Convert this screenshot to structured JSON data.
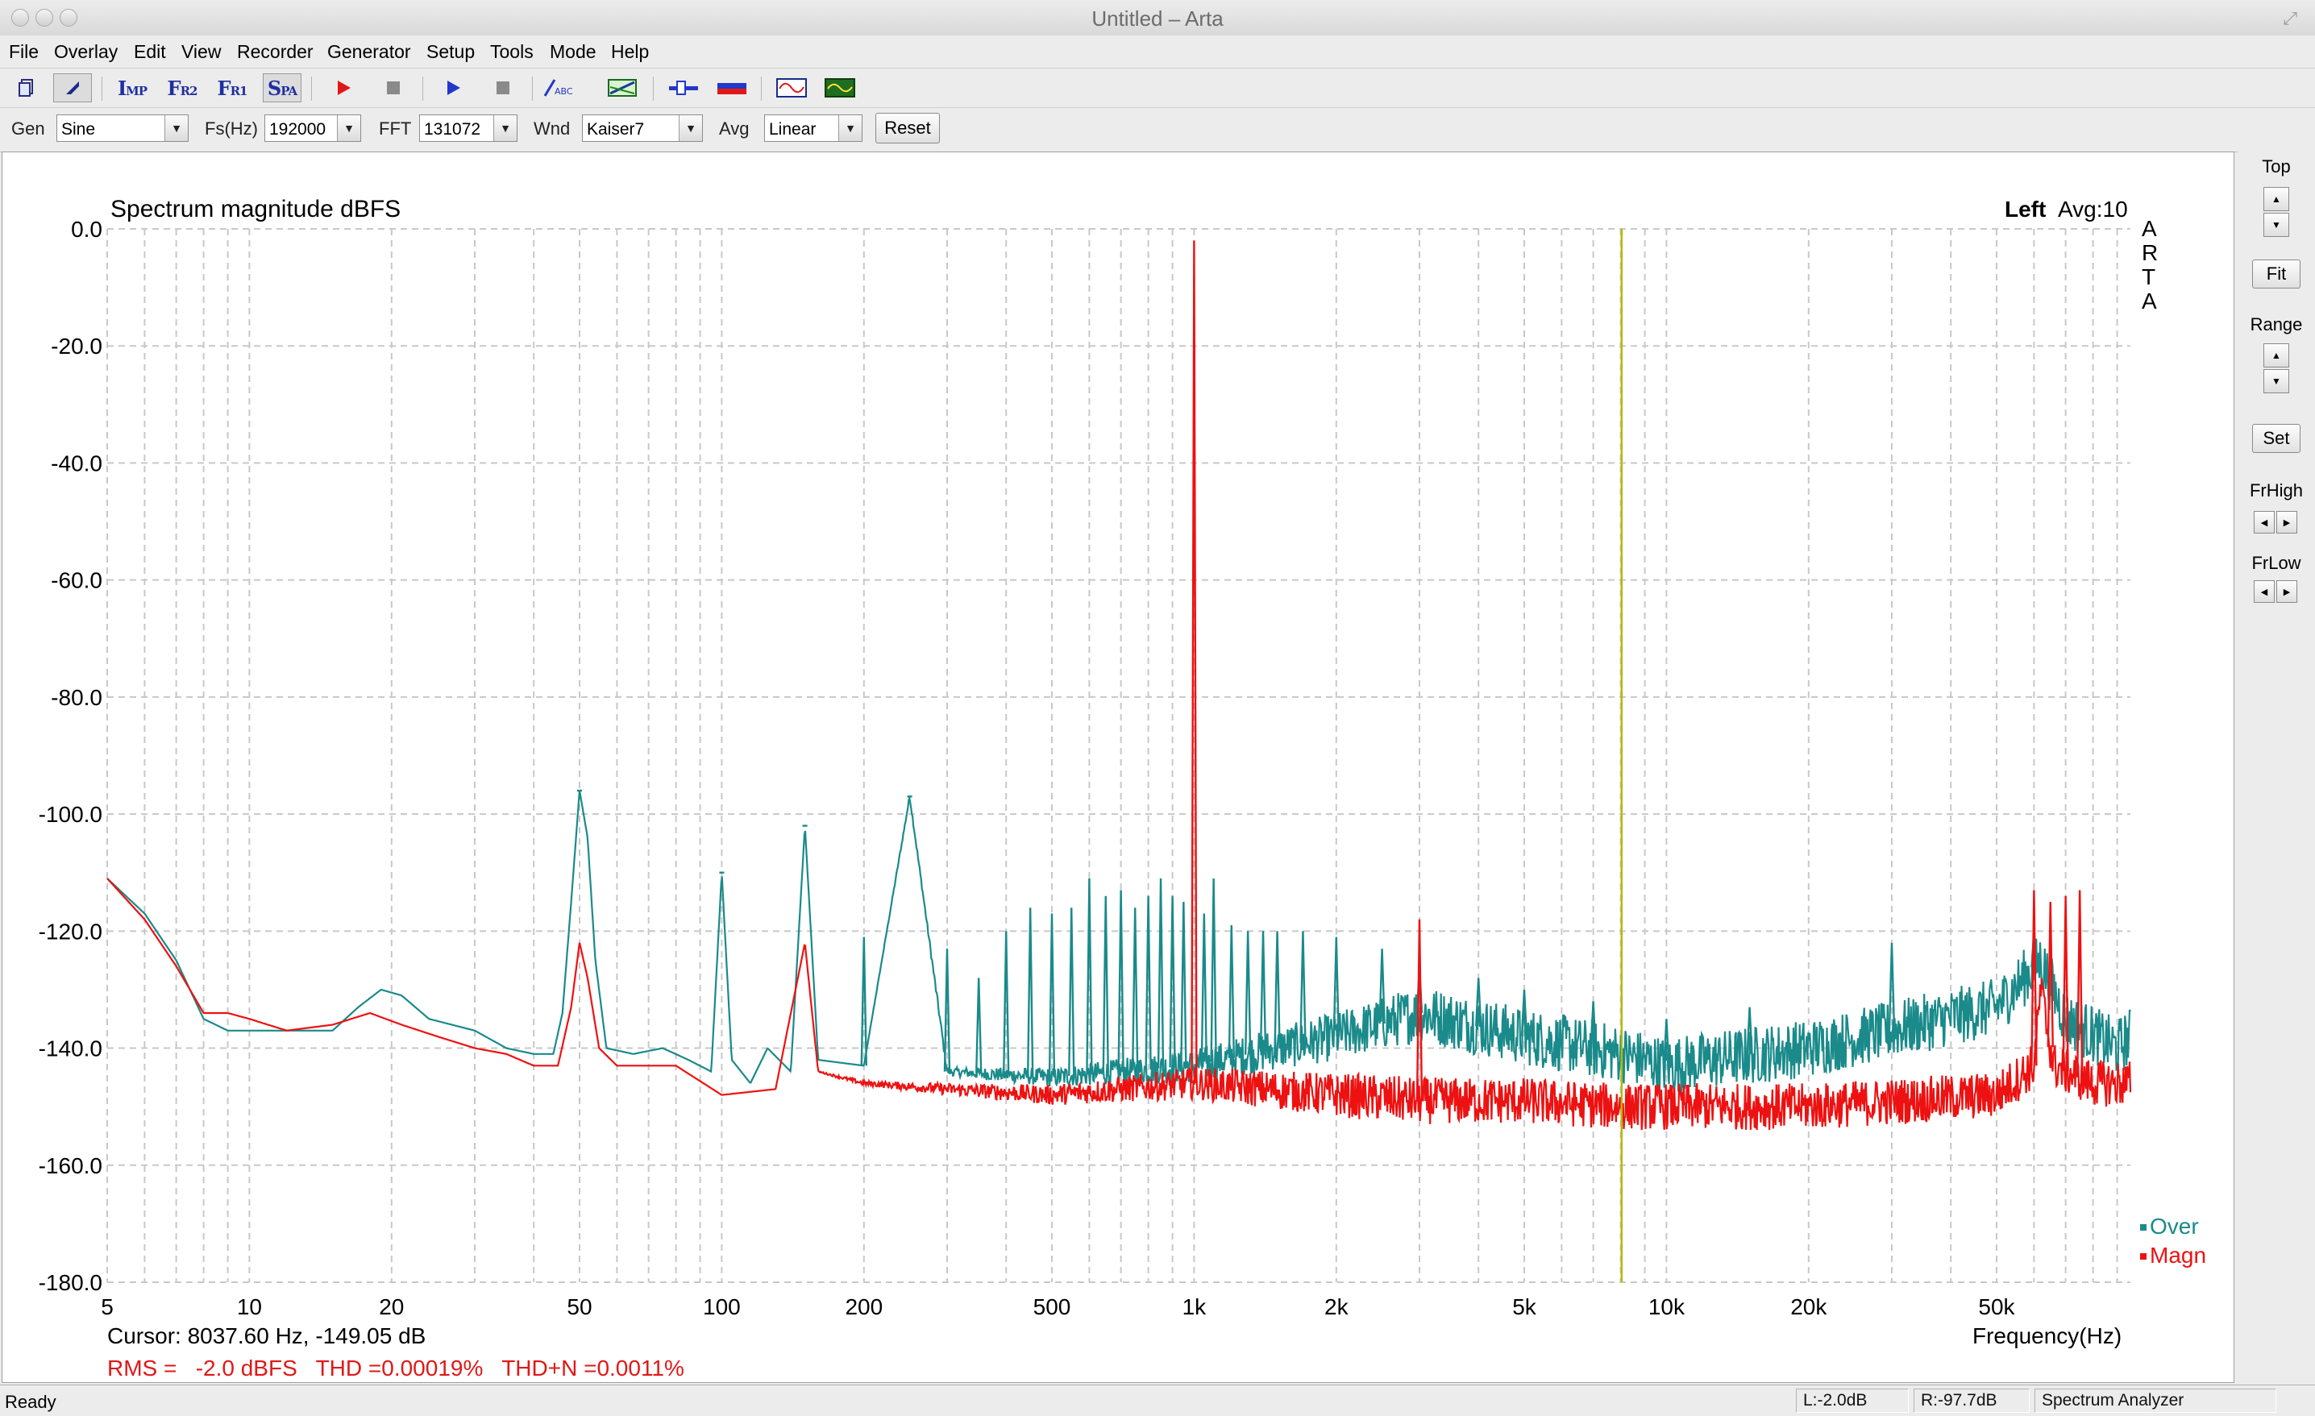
{
  "window": {
    "title": "Untitled – Arta"
  },
  "menu": [
    "File",
    "Overlay",
    "Edit",
    "View",
    "Recorder",
    "Generator",
    "Setup",
    "Tools",
    "Mode",
    "Help"
  ],
  "toolbar": {
    "imp": {
      "big": "I",
      "small": "MP"
    },
    "fr2": {
      "big": "F",
      "small": "R2"
    },
    "fr1": {
      "big": "F",
      "small": "R1"
    },
    "spa": {
      "big": "S",
      "small": "PA"
    },
    "abc": "ABC"
  },
  "params": {
    "gen_label": "Gen",
    "gen_value": "Sine",
    "fs_label": "Fs(Hz)",
    "fs_value": "192000",
    "fft_label": "FFT",
    "fft_value": "131072",
    "wnd_label": "Wnd",
    "wnd_value": "Kaiser7",
    "avg_label": "Avg",
    "avg_value": "Linear",
    "reset_label": "Reset"
  },
  "right_panel": {
    "top_label": "Top",
    "fit_label": "Fit",
    "range_label": "Range",
    "set_label": "Set",
    "frhigh_label": "FrHigh",
    "frlow_label": "FrLow"
  },
  "plot": {
    "title": "Spectrum magnitude dBFS",
    "channel": "Left",
    "avg": "Avg:10",
    "arta": [
      "A",
      "R",
      "T",
      "A"
    ],
    "cursor": "Cursor: 8037.60 Hz, -149.05 dB",
    "rms": "RMS =   -2.0 dBFS   THD =0.00019%   THD+N =0.0011%",
    "xlabel": "Frequency(Hz)",
    "legend": [
      "Over",
      "Magn"
    ]
  },
  "status": {
    "ready": "Ready",
    "left_level": "L:-2.0dB",
    "right_level": "R:-97.7dB",
    "mode": "Spectrum Analyzer"
  },
  "colors": {
    "over": "#1a8a8a",
    "magn": "#ee1111",
    "cursor": "#b5b800",
    "grid": "#c8c8c8"
  },
  "chart_data": {
    "type": "line",
    "title": "Spectrum magnitude dBFS",
    "xlabel": "Frequency(Hz)",
    "ylabel": "",
    "x_scale": "log",
    "xlim": [
      5,
      96000
    ],
    "ylim": [
      -180,
      0
    ],
    "x_ticks": [
      5,
      10,
      20,
      50,
      100,
      200,
      500,
      1000,
      2000,
      5000,
      10000,
      20000,
      50000
    ],
    "x_tick_labels": [
      "5",
      "10",
      "20",
      "50",
      "100",
      "200",
      "500",
      "1k",
      "2k",
      "5k",
      "10k",
      "20k",
      "50k"
    ],
    "y_ticks": [
      0,
      -20,
      -40,
      -60,
      -80,
      -100,
      -120,
      -140,
      -160,
      -180
    ],
    "y_tick_labels": [
      "0.0",
      "-20.0",
      "-40.0",
      "-60.0",
      "-80.0",
      "-100.0",
      "-120.0",
      "-140.0",
      "-160.0",
      "-180.0"
    ],
    "grid": true,
    "legend_position": "bottom-right",
    "cursor_x": 8037.6,
    "cursor_y": -149.05,
    "series": [
      {
        "name": "Over",
        "color": "#1a8a8a",
        "points": [
          [
            5,
            -111
          ],
          [
            6,
            -117
          ],
          [
            7,
            -125
          ],
          [
            8,
            -135
          ],
          [
            9,
            -137
          ],
          [
            10,
            -137
          ],
          [
            12,
            -137
          ],
          [
            15,
            -137
          ],
          [
            17,
            -133
          ],
          [
            19,
            -130
          ],
          [
            21,
            -131
          ],
          [
            24,
            -135
          ],
          [
            30,
            -137
          ],
          [
            35,
            -140
          ],
          [
            40,
            -141
          ],
          [
            44,
            -141
          ],
          [
            46,
            -134
          ],
          [
            48,
            -115
          ],
          [
            50,
            -96
          ],
          [
            52,
            -104
          ],
          [
            54,
            -125
          ],
          [
            57,
            -140
          ],
          [
            65,
            -141
          ],
          [
            75,
            -140
          ],
          [
            85,
            -142
          ],
          [
            95,
            -144
          ],
          [
            100,
            -110
          ],
          [
            105,
            -142
          ],
          [
            115,
            -146
          ],
          [
            125,
            -140
          ],
          [
            140,
            -144
          ],
          [
            150,
            -102
          ],
          [
            160,
            -142
          ],
          [
            200,
            -143
          ],
          [
            250,
            -97
          ],
          [
            300,
            -144
          ],
          [
            500,
            -145
          ],
          [
            1000,
            -143
          ],
          [
            2000,
            -138
          ],
          [
            3000,
            -134
          ],
          [
            5000,
            -138
          ],
          [
            8000,
            -141
          ],
          [
            10000,
            -143
          ],
          [
            20000,
            -140
          ],
          [
            50000,
            -133
          ],
          [
            62000,
            -125
          ],
          [
            70000,
            -135
          ],
          [
            90000,
            -140
          ],
          [
            96000,
            -138
          ]
        ],
        "peaks": [
          [
            50,
            -96
          ],
          [
            100,
            -110
          ],
          [
            150,
            -102
          ],
          [
            200,
            -121
          ],
          [
            250,
            -97
          ],
          [
            300,
            -123
          ],
          [
            350,
            -128
          ],
          [
            400,
            -120
          ],
          [
            450,
            -116
          ],
          [
            500,
            -117
          ],
          [
            550,
            -116
          ],
          [
            600,
            -111
          ],
          [
            650,
            -114
          ],
          [
            700,
            -113
          ],
          [
            750,
            -116
          ],
          [
            800,
            -114
          ],
          [
            850,
            -111
          ],
          [
            900,
            -114
          ],
          [
            950,
            -115
          ],
          [
            1050,
            -117
          ],
          [
            1100,
            -111
          ],
          [
            1200,
            -119
          ],
          [
            1300,
            -120
          ],
          [
            1400,
            -120
          ],
          [
            1500,
            -120
          ],
          [
            1700,
            -120
          ],
          [
            2000,
            -121
          ],
          [
            2500,
            -123
          ],
          [
            3000,
            -126
          ],
          [
            4000,
            -128
          ],
          [
            5000,
            -130
          ],
          [
            7000,
            -132
          ],
          [
            10000,
            -135
          ],
          [
            15000,
            -133
          ],
          [
            30000,
            -122
          ],
          [
            60000,
            -120
          ]
        ]
      },
      {
        "name": "Magn",
        "color": "#ee1111",
        "points": [
          [
            5,
            -111
          ],
          [
            6,
            -118
          ],
          [
            7,
            -126
          ],
          [
            8,
            -134
          ],
          [
            9,
            -134
          ],
          [
            10,
            -135
          ],
          [
            12,
            -137
          ],
          [
            15,
            -136
          ],
          [
            18,
            -134
          ],
          [
            21,
            -136
          ],
          [
            25,
            -138
          ],
          [
            30,
            -140
          ],
          [
            35,
            -141
          ],
          [
            40,
            -143
          ],
          [
            45,
            -143
          ],
          [
            48,
            -133
          ],
          [
            50,
            -122
          ],
          [
            52,
            -128
          ],
          [
            55,
            -140
          ],
          [
            60,
            -143
          ],
          [
            80,
            -143
          ],
          [
            100,
            -148
          ],
          [
            130,
            -147
          ],
          [
            150,
            -122
          ],
          [
            160,
            -144
          ],
          [
            200,
            -146
          ],
          [
            300,
            -147
          ],
          [
            500,
            -148
          ],
          [
            1000,
            -146
          ],
          [
            2000,
            -148
          ],
          [
            3000,
            -149
          ],
          [
            5000,
            -149
          ],
          [
            8000,
            -150
          ],
          [
            10000,
            -150
          ],
          [
            20000,
            -150
          ],
          [
            50000,
            -148
          ],
          [
            60000,
            -143
          ],
          [
            62000,
            -130
          ],
          [
            66000,
            -143
          ],
          [
            80000,
            -146
          ],
          [
            96000,
            -146
          ]
        ],
        "peaks": [
          [
            1000,
            -2
          ],
          [
            3000,
            -118
          ],
          [
            60000,
            -113
          ],
          [
            65000,
            -115
          ],
          [
            70000,
            -114
          ],
          [
            75000,
            -113
          ]
        ]
      }
    ]
  }
}
